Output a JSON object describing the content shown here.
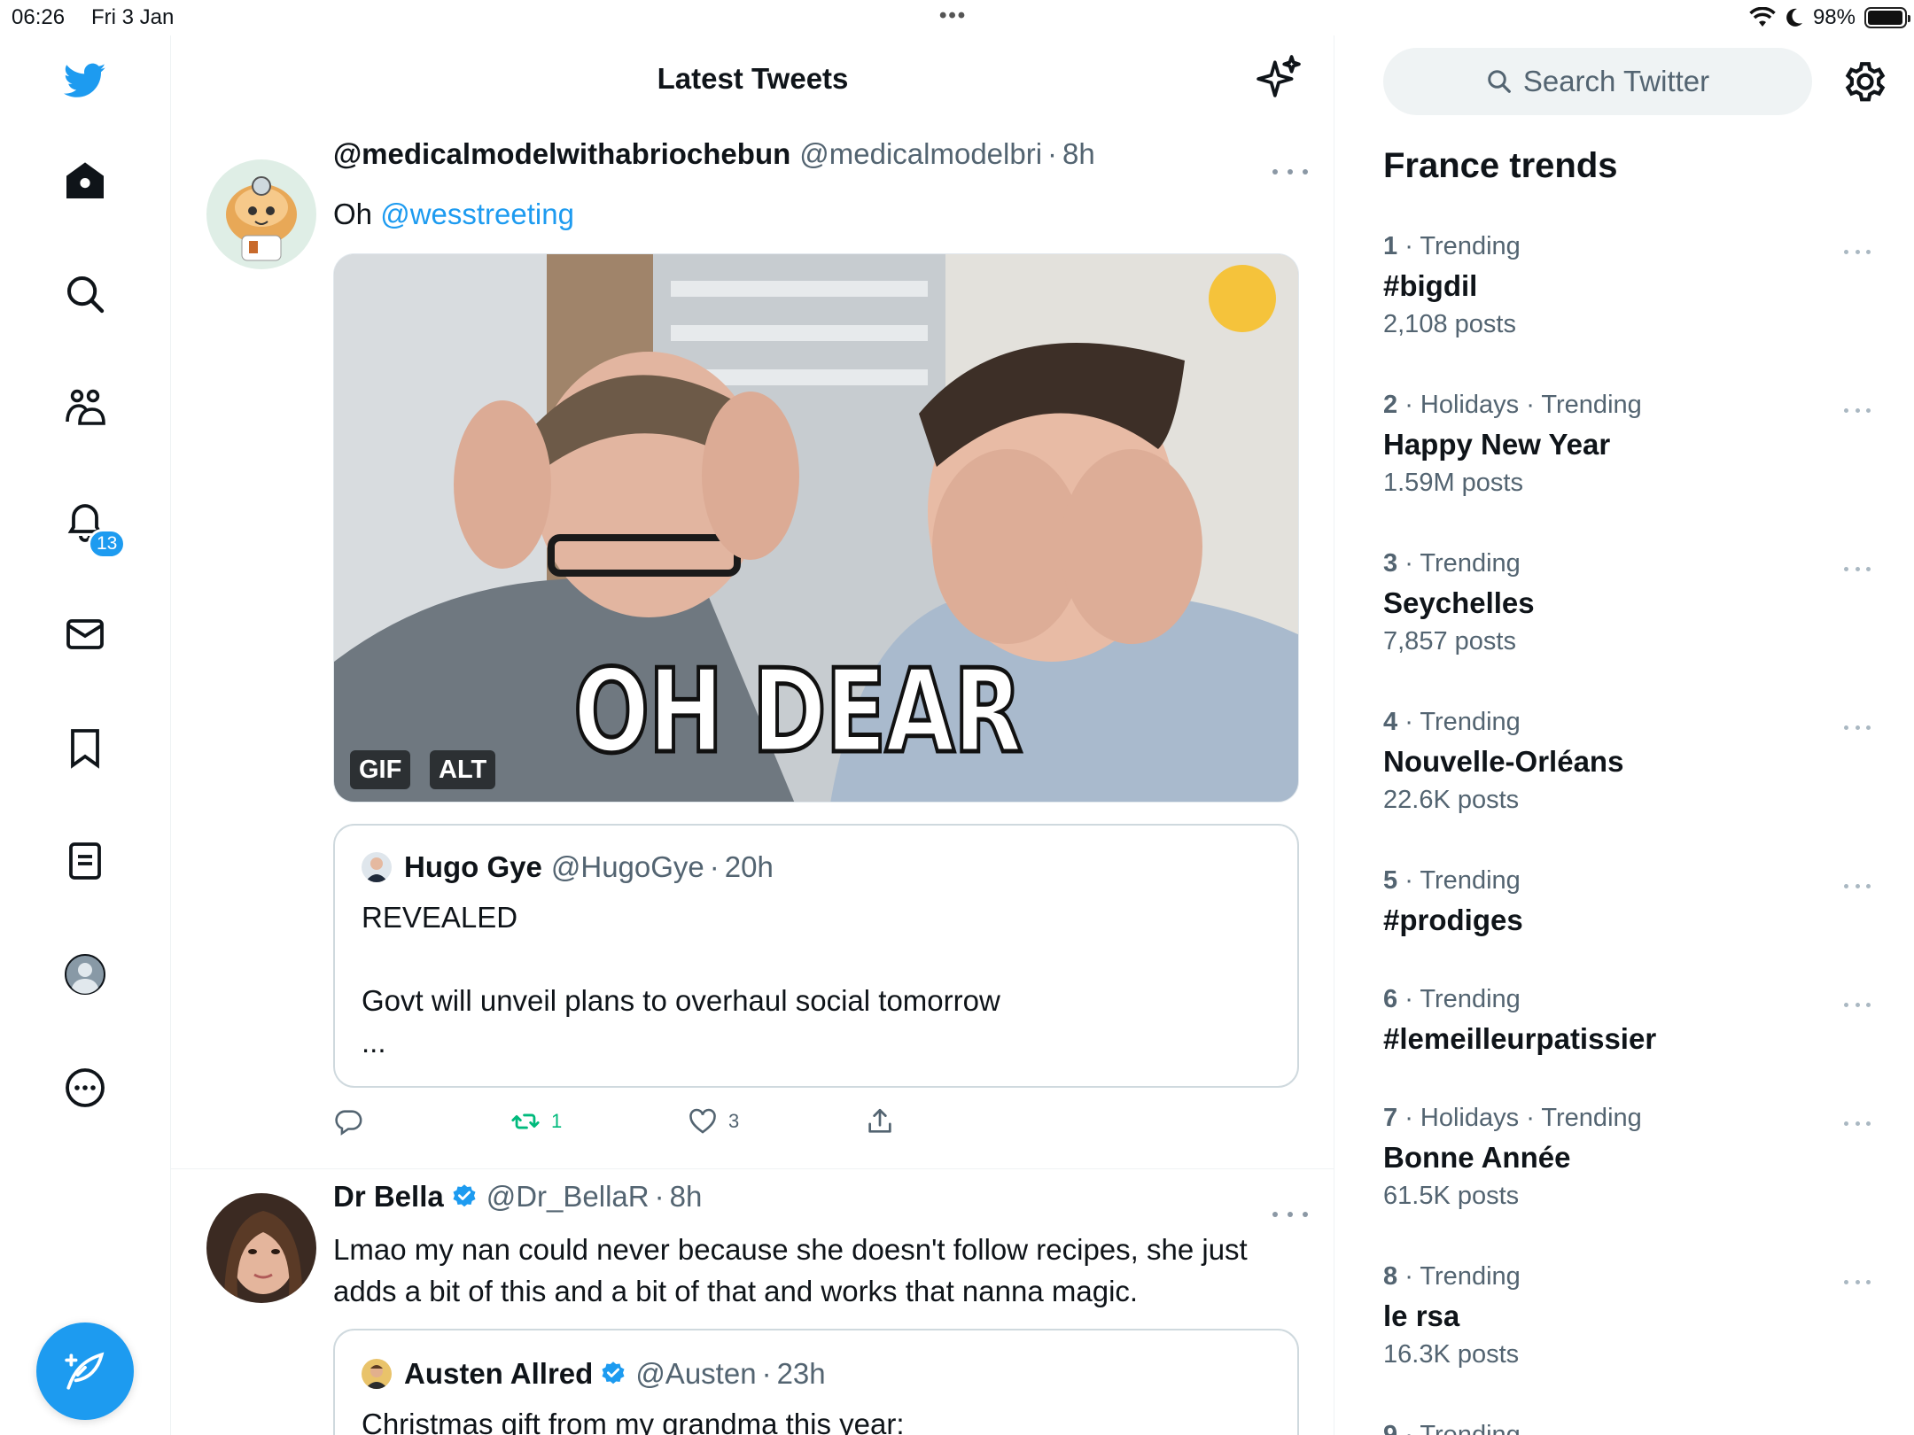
{
  "status_bar": {
    "time": "06:26",
    "date": "Fri 3 Jan",
    "battery_percent": "98%",
    "battery_level": 0.98
  },
  "nav": {
    "items": [
      "twitter-logo",
      "home-icon",
      "search-icon",
      "communities-icon",
      "notifications-icon",
      "messages-icon",
      "bookmarks-icon",
      "lists-icon",
      "profile-icon",
      "more-icon"
    ],
    "notifications_badge": "13",
    "compose_icon": "compose-tweet-icon"
  },
  "main": {
    "title": "Latest Tweets",
    "tweets": [
      {
        "name": "@medicalmodelwithabriochebun",
        "handle": "@medicalmodelbri",
        "sep": "·",
        "time": "8h",
        "text_prefix": "Oh",
        "mention": "@wesstreeting",
        "media": {
          "overlay_text": "OH DEAR",
          "tags": [
            "GIF",
            "ALT"
          ]
        },
        "quote": {
          "name": "Hugo Gye",
          "handle": "@HugoGye",
          "sep": "·",
          "time": "20h",
          "text": "REVEALED\n\nGovt will unveil plans to overhaul social tomorrow\n..."
        },
        "actions": {
          "reply": "",
          "retweets": "1",
          "likes": "3",
          "share": ""
        }
      },
      {
        "name": "Dr Bella",
        "handle": "@Dr_BellaR",
        "sep": "·",
        "time": "8h",
        "text": "Lmao my nan could never because she doesn't follow recipes, she just adds a bit of this and a bit of that and works that nanna magic.",
        "quote": {
          "name": "Austen Allred",
          "handle": "@Austen",
          "sep": "·",
          "time": "23h",
          "text": "Christmas gift from my grandma this year:"
        }
      }
    ]
  },
  "sidebar": {
    "search_placeholder": "Search Twitter",
    "trends_title": "France trends",
    "trends": [
      {
        "rank": "1",
        "context": "Trending",
        "name": "#bigdil",
        "count": "2,108 posts"
      },
      {
        "rank": "2",
        "context": "Holidays · Trending",
        "name": "Happy New Year",
        "count": "1.59M posts"
      },
      {
        "rank": "3",
        "context": "Trending",
        "name": "Seychelles",
        "count": "7,857 posts"
      },
      {
        "rank": "4",
        "context": "Trending",
        "name": "Nouvelle-Orléans",
        "count": "22.6K posts"
      },
      {
        "rank": "5",
        "context": "Trending",
        "name": "#prodiges",
        "count": ""
      },
      {
        "rank": "6",
        "context": "Trending",
        "name": "#lemeilleurpatissier",
        "count": ""
      },
      {
        "rank": "7",
        "context": "Holidays · Trending",
        "name": "Bonne Année",
        "count": "61.5K posts"
      },
      {
        "rank": "8",
        "context": "Trending",
        "name": "le rsa",
        "count": "16.3K posts"
      },
      {
        "rank": "9",
        "context": "Trending",
        "name": "",
        "count": ""
      }
    ]
  },
  "colors": {
    "accent": "#1d9bf0",
    "retweet_green": "#00ba7c",
    "secondary_text": "#536471"
  }
}
